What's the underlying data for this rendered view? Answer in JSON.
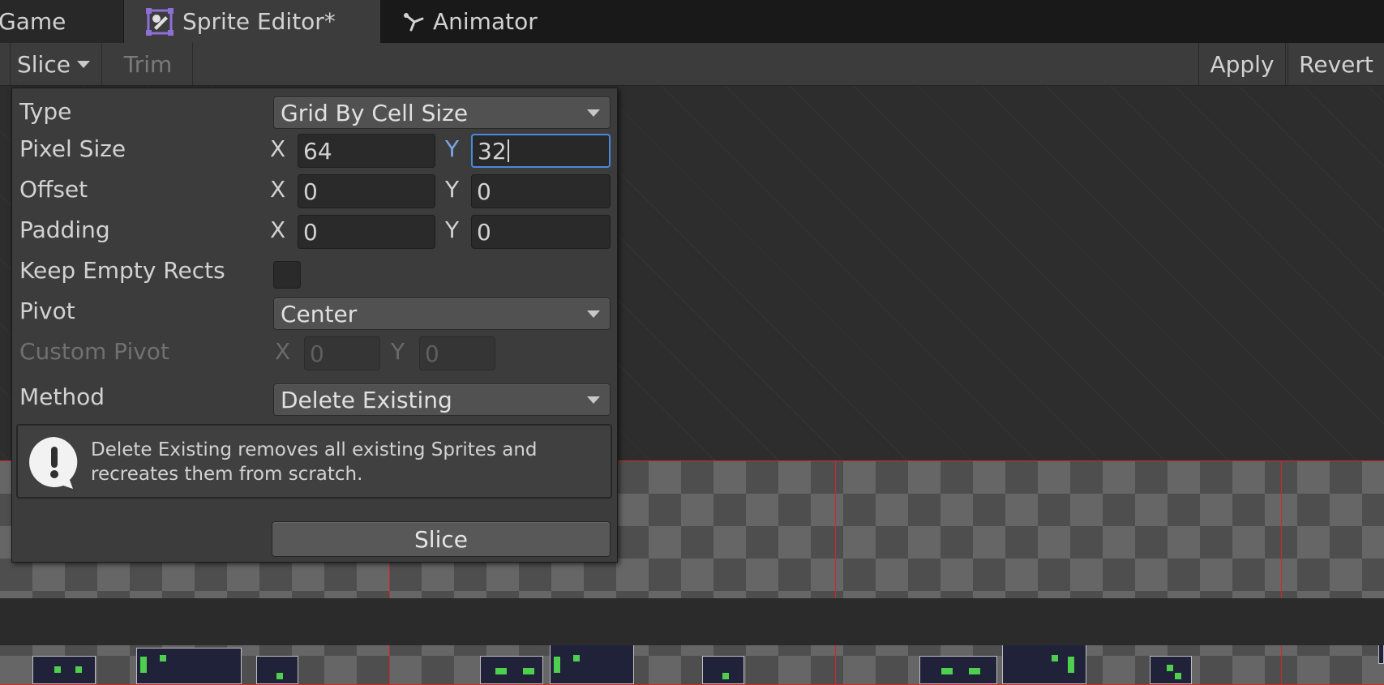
{
  "tabs": {
    "game": "Game",
    "sprite_editor": "Sprite Editor*",
    "animator": "Animator"
  },
  "toolbar": {
    "slice": "Slice",
    "trim": "Trim",
    "apply": "Apply",
    "revert": "Revert"
  },
  "slice_panel": {
    "type_label": "Type",
    "type_value": "Grid By Cell Size",
    "pixel_size_label": "Pixel Size",
    "pixel_size_x": "64",
    "pixel_size_y": "32",
    "offset_label": "Offset",
    "offset_x": "0",
    "offset_y": "0",
    "padding_label": "Padding",
    "padding_x": "0",
    "padding_y": "0",
    "keep_empty_label": "Keep Empty Rects",
    "keep_empty_checked": false,
    "pivot_label": "Pivot",
    "pivot_value": "Center",
    "custom_pivot_label": "Custom Pivot",
    "custom_pivot_x": "0",
    "custom_pivot_y": "0",
    "method_label": "Method",
    "method_value": "Delete Existing",
    "axis_x": "X",
    "axis_y": "Y",
    "help_text": "Delete Existing removes all existing Sprites and recreates them from scratch.",
    "slice_button": "Slice"
  },
  "colors": {
    "focus": "#4a89dc",
    "slice_line": "#d02828",
    "sprite_accent": "#4ecf4e",
    "icon_purple": "#8e6fd8"
  }
}
